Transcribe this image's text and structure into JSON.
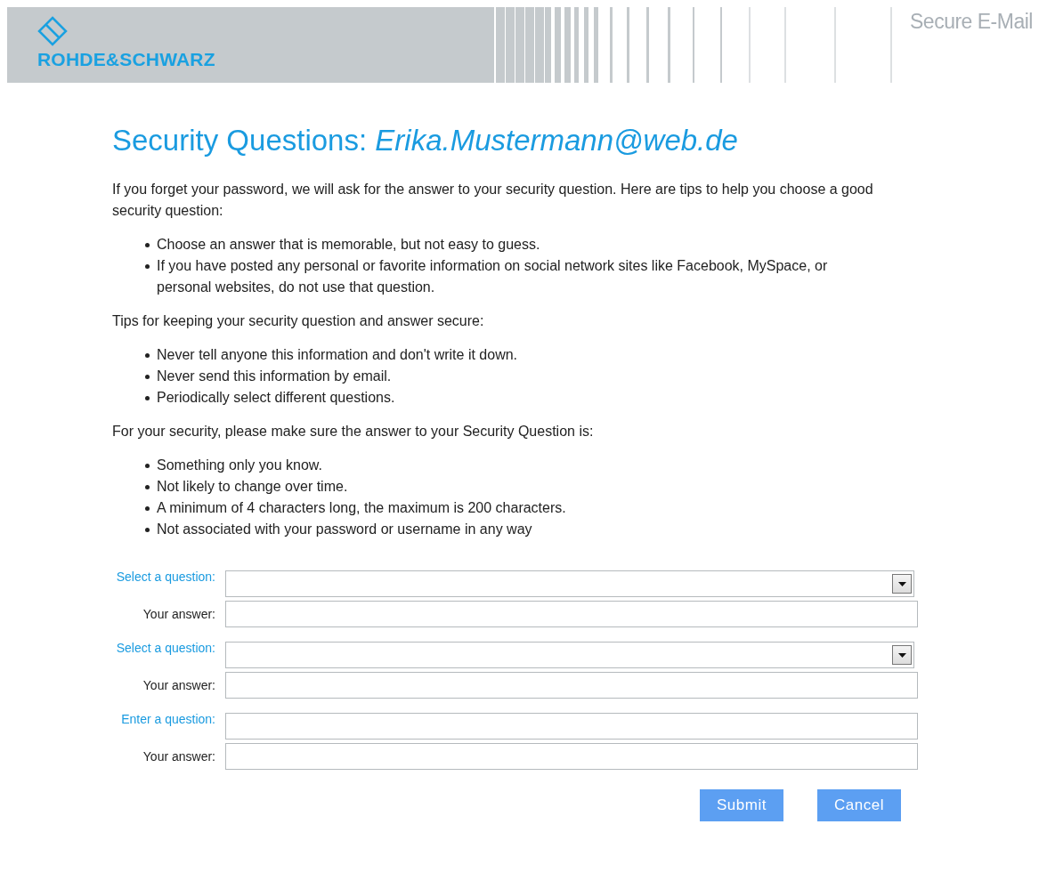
{
  "header": {
    "logo": "ROHDE&SCHWARZ",
    "product": "Secure E-Mail"
  },
  "title": "Security Questions: *Erika.Mustermann@web.de*",
  "sections": [
    {
      "intro": "If you forget your password, we will ask for the answer to your security question. Here are tips to help you choose a good security question:",
      "bullets": [
        "Choose an answer that is memorable, but not easy to guess.",
        "If you have posted any personal or favorite information on social network sites like Facebook, MySpace, or personal websites, do not use that question."
      ]
    },
    {
      "intro": "Tips for keeping your security question and answer secure:",
      "bullets": [
        "Never tell anyone this information and don't write it down.",
        "Never send this information by email.",
        "Periodically select different questions."
      ]
    },
    {
      "intro": "For your security, please make sure the answer to your Security Question is:",
      "bullets": [
        "Something only you know.",
        "Not likely to change over time.",
        "A minimum of 4 characters long, the maximum is 200 characters.",
        "Not associated with your password or username in any way"
      ]
    }
  ],
  "form": [
    [
      {
        "label": "Select a question:",
        "kind": "select",
        "emphasized": true
      },
      {
        "label": "Your answer:",
        "kind": "text",
        "emphasized": false
      }
    ],
    [
      {
        "label": "Select a question:",
        "kind": "select",
        "emphasized": true
      },
      {
        "label": "Your answer:",
        "kind": "text",
        "emphasized": false
      }
    ],
    [
      {
        "label": "Enter a question:",
        "kind": "text",
        "emphasized": true
      },
      {
        "label": "Your answer:",
        "kind": "text",
        "emphasized": false
      }
    ]
  ],
  "buttons": [
    "Submit",
    "Cancel"
  ]
}
